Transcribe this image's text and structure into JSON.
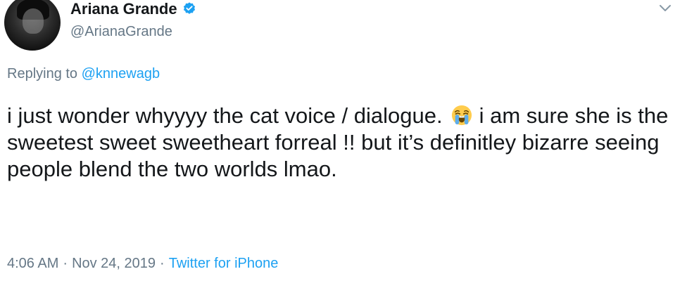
{
  "tweet": {
    "display_name": "Ariana Grande",
    "verified_icon": "verified-badge-icon",
    "handle": "@ArianaGrande",
    "menu_icon": "chevron-down-icon",
    "replying_prefix": "Replying to",
    "replying_to": "@knnewagb",
    "text_part1": "i just wonder whyyyy the cat voice / dialogue.",
    "emoji": "loudly-crying-face-icon",
    "text_part2": "i am sure she is the sweetest sweet sweetheart forreal !! but it’s definitley bizarre seeing people blend the two worlds lmao.",
    "time": "4:06 AM",
    "separator": "·",
    "date": "Nov 24, 2019",
    "source": "Twitter for iPhone"
  },
  "colors": {
    "accent": "#1da1f2",
    "text": "#14171a",
    "muted": "#657786"
  }
}
